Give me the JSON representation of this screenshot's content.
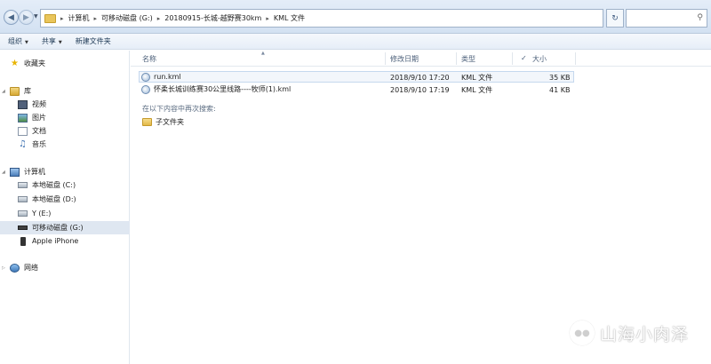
{
  "address": {
    "crumbs": [
      "计算机",
      "可移动磁盘 (G:)",
      "20180915-长城-越野赛30km",
      "KML 文件"
    ],
    "refresh_icon": "refresh-icon",
    "search_icon": "search-icon"
  },
  "toolbar": {
    "organize": "组织",
    "share": "共享",
    "new_folder": "新建文件夹"
  },
  "nav": {
    "favorites": "收藏夹",
    "libraries": "库",
    "videos": "视频",
    "pictures": "图片",
    "documents": "文档",
    "music": "音乐",
    "computer": "计算机",
    "drive_c": "本地磁盘 (C:)",
    "drive_d": "本地磁盘 (D:)",
    "drive_e": "Y (E:)",
    "drive_g": "可移动磁盘 (G:)",
    "iphone": "Apple iPhone",
    "network": "网络"
  },
  "columns": {
    "name": "名称",
    "modified": "修改日期",
    "type": "类型",
    "size": "大小"
  },
  "files": [
    {
      "name": "run.kml",
      "modified": "2018/9/10 17:20",
      "type": "KML 文件",
      "size": "35 KB"
    },
    {
      "name": "怀柔长城训练赛30公里线路----牧师(1).kml",
      "modified": "2018/9/10 17:19",
      "type": "KML 文件",
      "size": "41 KB"
    }
  ],
  "search_again": {
    "label": "在以下内容中再次搜索:",
    "subfolders": "子文件夹"
  },
  "watermark": {
    "text": "山海小肉泽"
  }
}
